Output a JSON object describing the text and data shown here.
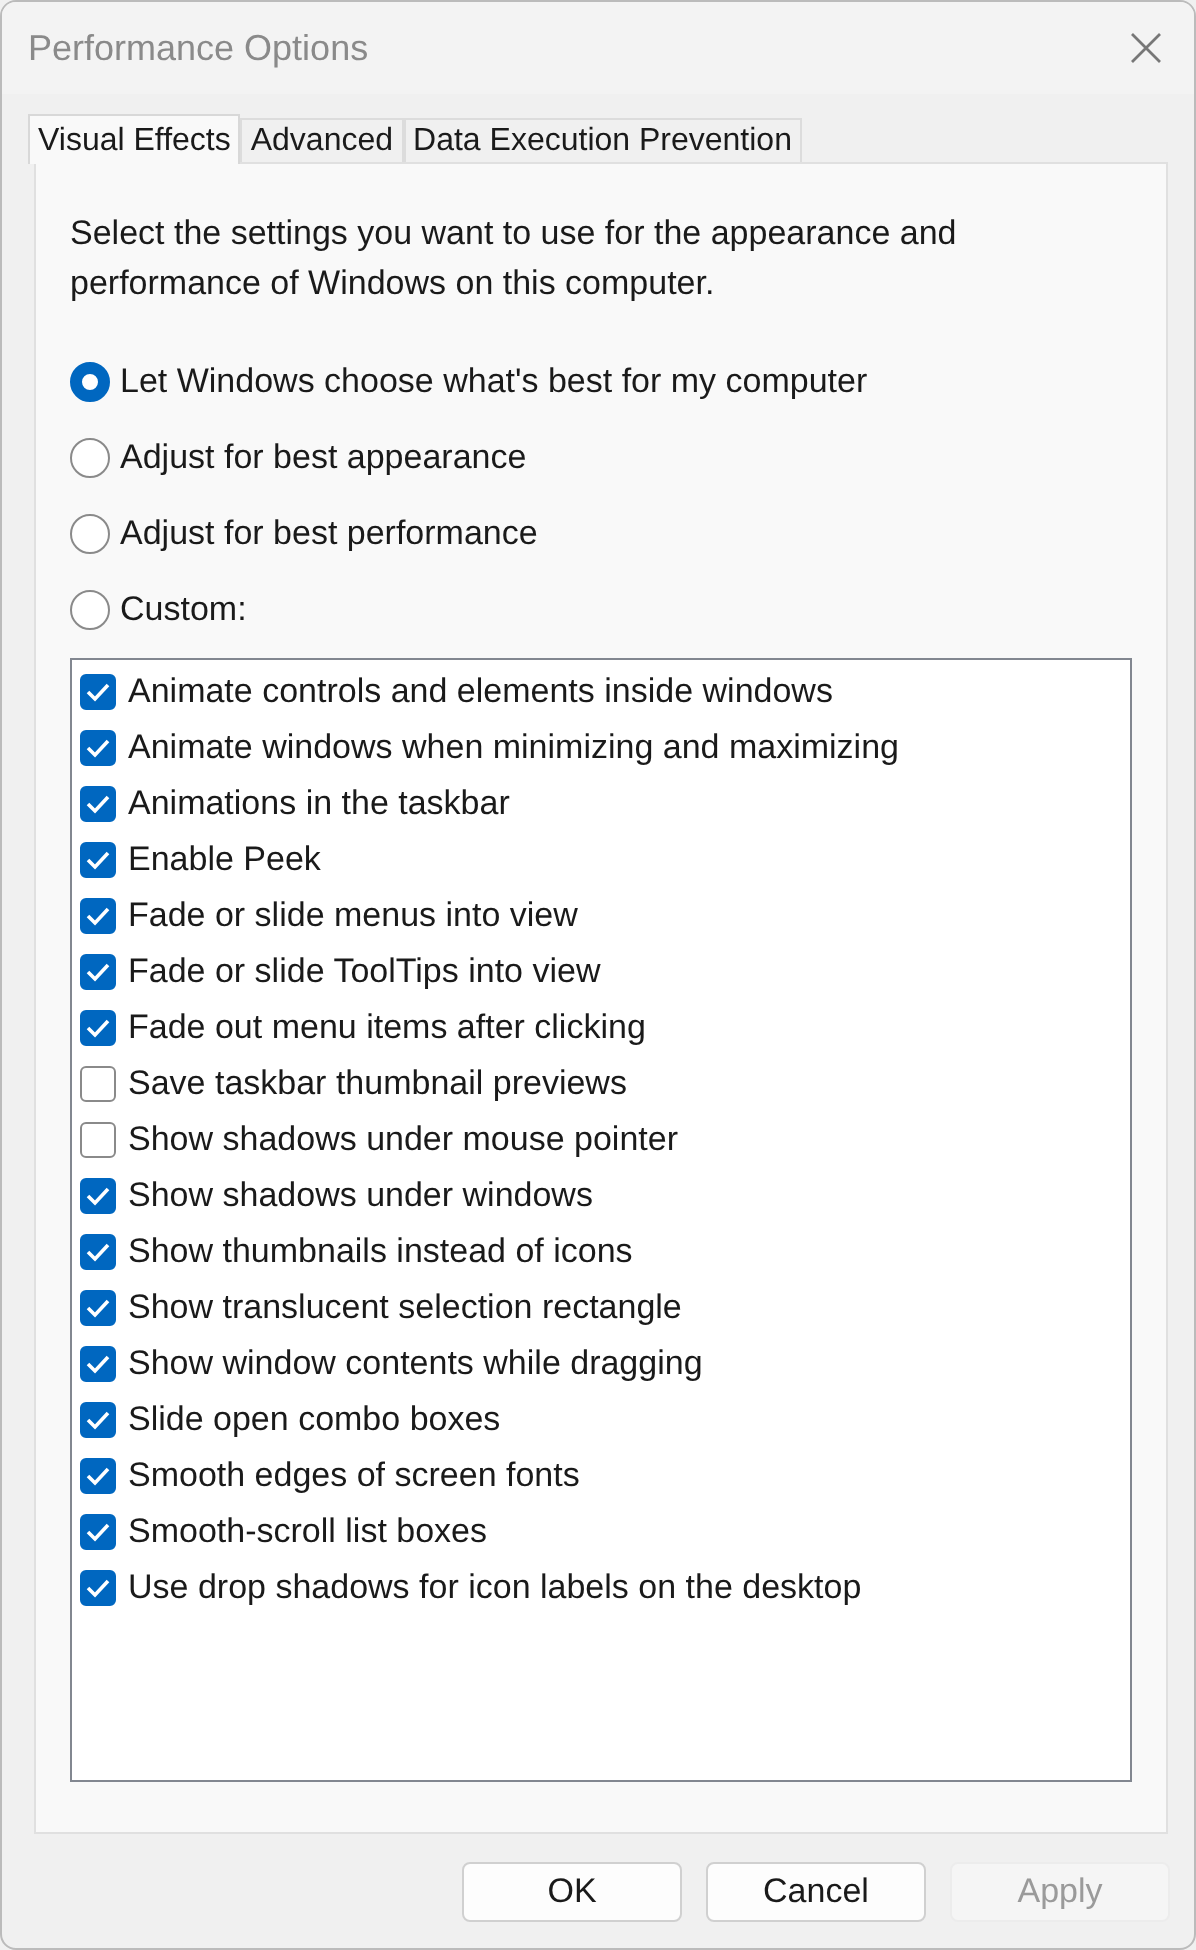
{
  "window": {
    "title": "Performance Options"
  },
  "tabs": [
    {
      "label": "Visual Effects",
      "selected": true
    },
    {
      "label": "Advanced",
      "selected": false
    },
    {
      "label": "Data Execution Prevention",
      "selected": false
    }
  ],
  "description": "Select the settings you want to use for the appearance and performance of Windows on this computer.",
  "options": [
    {
      "label": "Let Windows choose what's best for my computer",
      "selected": true
    },
    {
      "label": "Adjust for best appearance",
      "selected": false
    },
    {
      "label": "Adjust for best performance",
      "selected": false
    },
    {
      "label": "Custom:",
      "selected": false
    }
  ],
  "effects": [
    {
      "label": "Animate controls and elements inside windows",
      "checked": true
    },
    {
      "label": "Animate windows when minimizing and maximizing",
      "checked": true
    },
    {
      "label": "Animations in the taskbar",
      "checked": true
    },
    {
      "label": "Enable Peek",
      "checked": true
    },
    {
      "label": "Fade or slide menus into view",
      "checked": true
    },
    {
      "label": "Fade or slide ToolTips into view",
      "checked": true
    },
    {
      "label": "Fade out menu items after clicking",
      "checked": true
    },
    {
      "label": "Save taskbar thumbnail previews",
      "checked": false
    },
    {
      "label": "Show shadows under mouse pointer",
      "checked": false
    },
    {
      "label": "Show shadows under windows",
      "checked": true
    },
    {
      "label": "Show thumbnails instead of icons",
      "checked": true
    },
    {
      "label": "Show translucent selection rectangle",
      "checked": true
    },
    {
      "label": "Show window contents while dragging",
      "checked": true
    },
    {
      "label": "Slide open combo boxes",
      "checked": true
    },
    {
      "label": "Smooth edges of screen fonts",
      "checked": true
    },
    {
      "label": "Smooth-scroll list boxes",
      "checked": true
    },
    {
      "label": "Use drop shadows for icon labels on the desktop",
      "checked": true
    }
  ],
  "buttons": [
    {
      "label": "OK",
      "disabled": false
    },
    {
      "label": "Cancel",
      "disabled": false
    },
    {
      "label": "Apply",
      "disabled": true
    }
  ]
}
